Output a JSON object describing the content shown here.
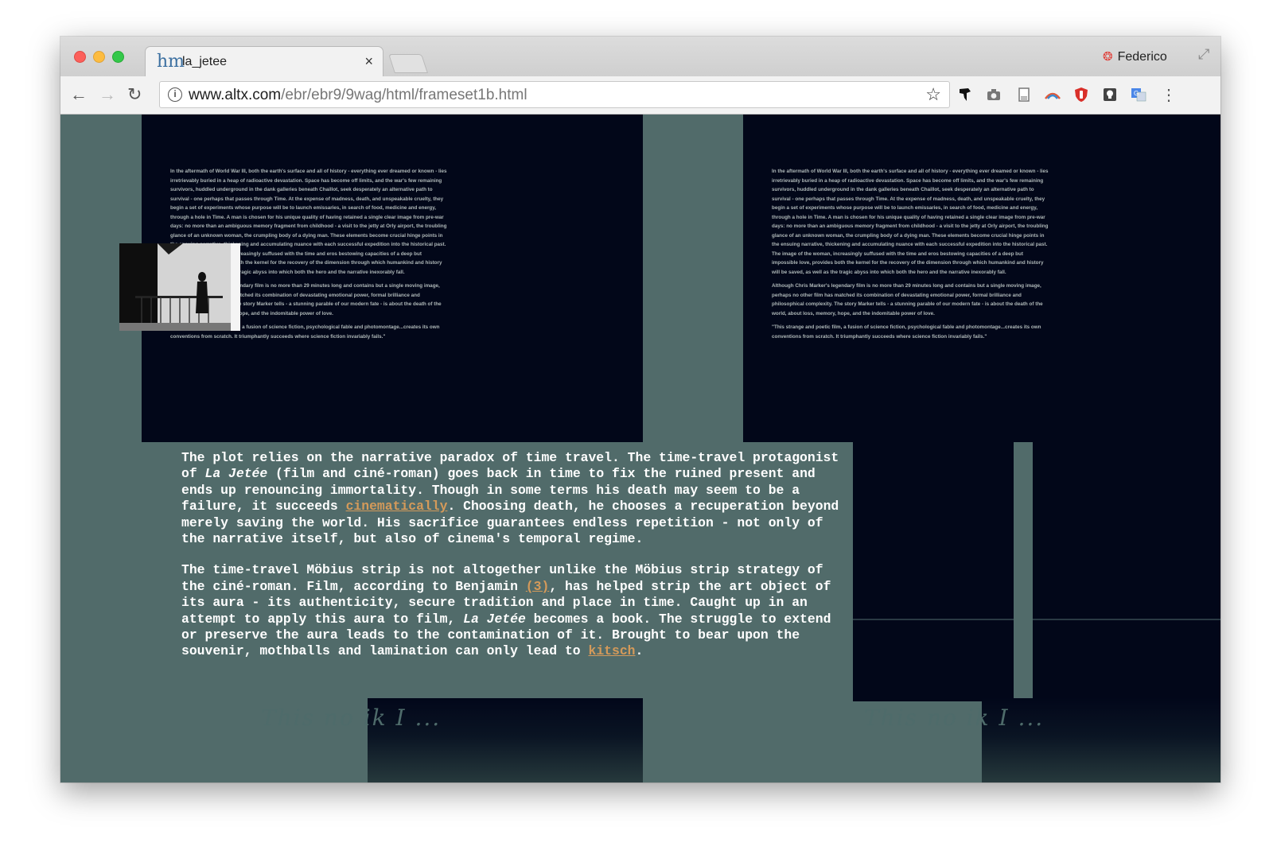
{
  "browser": {
    "tab_title": "la_jetee",
    "tab_favicon": "hm",
    "tab_close": "×",
    "profile_name": "Federico",
    "url_host": "www.altx.com",
    "url_path": "/ebr/ebr9/9wag/html/frameset1b.html"
  },
  "toolbar_icons": {
    "back": "back-arrow-icon",
    "forward": "forward-arrow-icon",
    "reload": "reload-icon",
    "info": "info-icon",
    "bookmark": "star-icon",
    "extensions": [
      "bird-extension-icon",
      "camera-icon",
      "document-icon",
      "rainbow-extension-icon",
      "shield-icon",
      "lightbulb-icon",
      "translate-icon",
      "more-menu-icon"
    ]
  },
  "content": {
    "paragraph1": {
      "before_title": "The plot relies on the narrative paradox of time travel. The time-travel protagonist of ",
      "title": "La Jetée",
      "after_title": " (film and ciné-roman) goes back in time to fix the ruined present and ends up renouncing immortality. Though in some terms his death may seem to be a failure, it succeeds ",
      "link": "cinematically",
      "after_link": ". Choosing death, he chooses a recuperation beyond merely saving the world. His sacrifice guarantees endless repetition - not only of the narrative itself, but also of cinema's temporal regime."
    },
    "paragraph2": {
      "before_link": "The time-travel Möbius strip is not altogether unlike the Möbius strip strategy of the ciné-roman. Film, according to Benjamin ",
      "link": "(3)",
      "after_link": ", has helped strip the art object of its aura - its authenticity, secure tradition and place in time. Caught up in an attempt to apply this aura to film, ",
      "title": "La Jetée",
      "after_title": " becomes a book. The struggle to extend or preserve the aura leads to the contamination of it. Brought to bear upon the souvenir, mothballs and lamination can only lead to ",
      "link2": "kitsch",
      "end": "."
    }
  },
  "scanned_page": {
    "paragraphs": [
      "In the aftermath of World War III, both the earth's surface and all of history - everything ever dreamed or known - lies irretrievably buried in a heap of radioactive devastation. Space has become off limits, and the war's few remaining survivors, huddled underground in the dank galleries beneath Chaillot, seek desperately an alternative path to survival - one perhaps that passes through Time. At the expense of madness, death, and unspeakable cruelty, they begin a set of experiments whose purpose will be to launch emissaries, in search of food, medicine and energy, through a hole in Time. A man is chosen for his unique quality of having retained a single clear image from pre-war days: no more than an ambiguous memory fragment from childhood - a visit to the jetty at Orly airport, the troubling glance of an unknown woman, the crumpling body of a dying man. These elements become crucial hinge points in the ensuing narrative, thickening and accumulating nuance with each successful expedition into the historical past. The image of the woman, increasingly suffused with the time and eros bestowing capacities of a deep but impossible love, provides both the kernel for the recovery of the dimension through which humankind and history will be saved, as well as the tragic abyss into which both the hero and the narrative inexorably fall.",
      "Although Chris Marker's legendary film is no more than 29 minutes long and contains but a single moving image, perhaps no other film has matched its combination of devastating emotional power, formal brilliance and philosophical complexity. The story Marker tells - a stunning parable of our modern fate - is about the death of the world, about loss, memory, hope, and the indomitable power of love.",
      "\"This strange and poetic film, a fusion of science fiction, psychological fable and photomontage...creates its own conventions from scratch. It triumphantly succeeds where science fiction invariably fails.\""
    ],
    "handwriting": "This no ik I ..."
  }
}
